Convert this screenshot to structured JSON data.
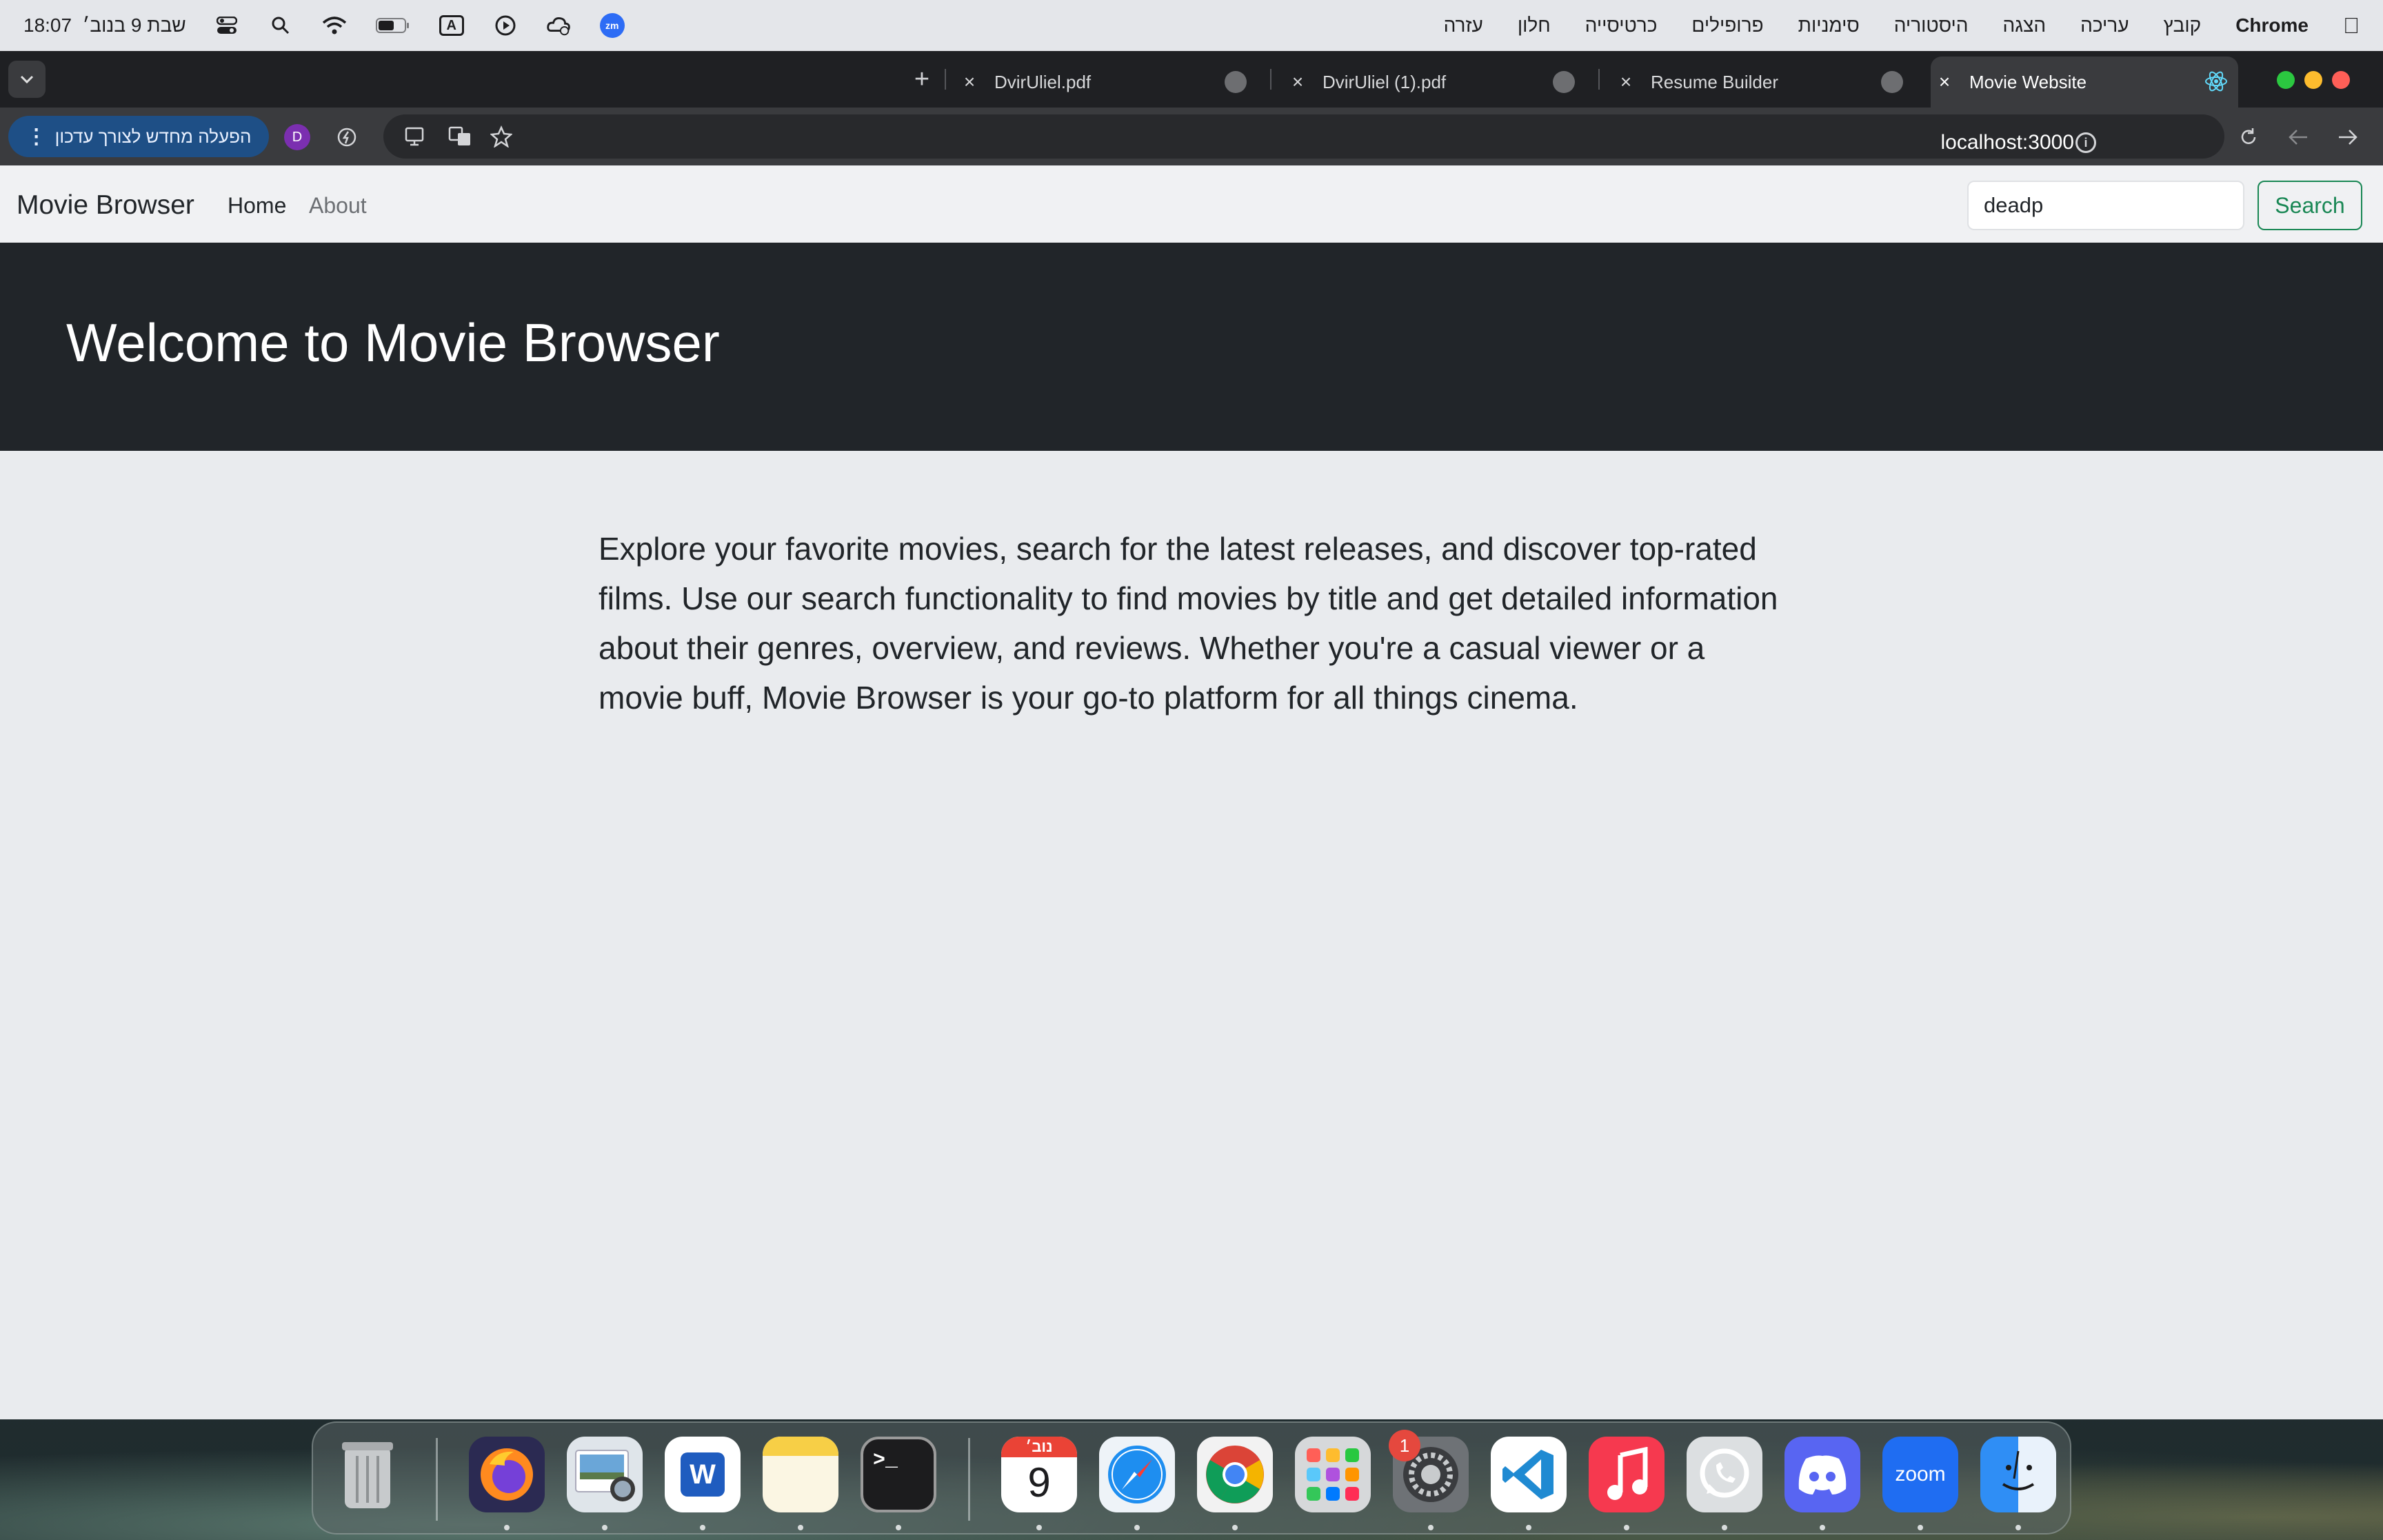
{
  "menubar": {
    "clock": "18:07",
    "date": "שבת 9 בנוב׳",
    "app_name": "Chrome",
    "menus": [
      "קובץ",
      "עריכה",
      "הצגה",
      "היסטוריה",
      "סימניות",
      "פרופילים",
      "כרטיסייה",
      "חלון",
      "עזרה"
    ],
    "status_icons": [
      "control-center-icon",
      "spotlight-icon",
      "wifi-icon",
      "battery-icon",
      "input-source-icon",
      "play-icon",
      "cloud-weather-icon",
      "zoom-status-icon"
    ],
    "input_source_label": "A",
    "zoom_label": "zm"
  },
  "tabs": [
    {
      "title": "DvirUliel.pdf",
      "active": false
    },
    {
      "title": "DvirUliel (1).pdf",
      "active": false
    },
    {
      "title": "Resume Builder",
      "active": false
    },
    {
      "title": "Movie Website",
      "active": true
    }
  ],
  "toolbar": {
    "update_label": "הפעלה מחדש לצורך עדכון",
    "profile_initial": "D",
    "url": "localhost:3000",
    "info_glyph": "i"
  },
  "page": {
    "brand": "Movie Browser",
    "nav": [
      "Home",
      "About"
    ],
    "search_value": "deadp",
    "search_button": "Search",
    "hero_title": "Welcome to Movie Browser",
    "intro": "Explore your favorite movies, search for the latest releases, and discover top-rated films. Use our search functionality to find movies by title and get detailed information about their genres, overview, and reviews. Whether you're a casual viewer or a movie buff, Movie Browser is your go-to platform for all things cinema."
  },
  "dock": {
    "apps": [
      "Trash",
      "Firefox",
      "Preview",
      "Word",
      "Notes",
      "Terminal",
      "Calendar",
      "Safari",
      "Chrome",
      "Launchpad",
      "System Settings",
      "VS Code",
      "Music",
      "WhatsApp",
      "Discord",
      "Zoom",
      "Finder"
    ],
    "word_label": "W",
    "terminal_label": ">_",
    "calendar_month": "נוב׳",
    "calendar_day": "9",
    "settings_badge": "1",
    "zoom_label": "zoom"
  },
  "colors": {
    "hero_bg": "#212529",
    "search_green": "#198754",
    "update_btn": "#1e4f86"
  }
}
